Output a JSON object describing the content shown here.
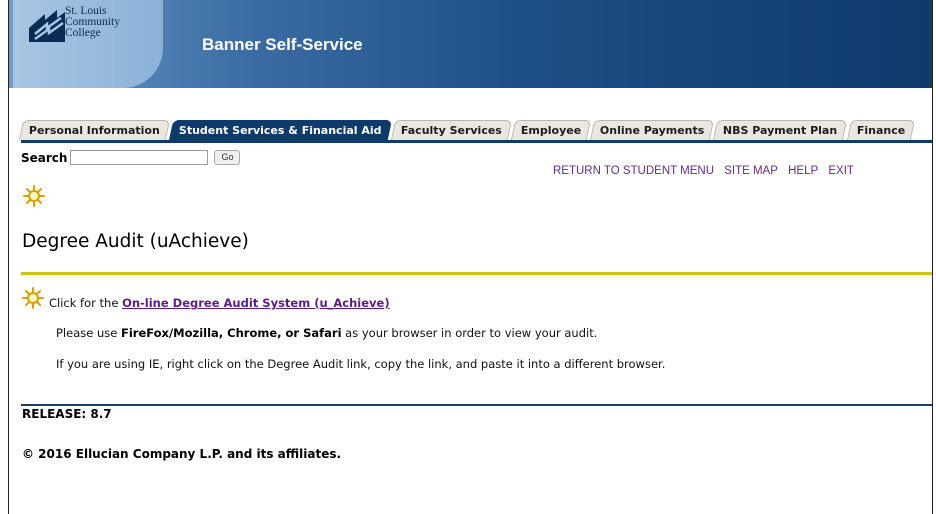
{
  "header": {
    "logo_lines": [
      "St. Louis",
      "Community",
      "College"
    ],
    "app_title": "Banner Self-Service"
  },
  "tabs": [
    {
      "label": "Personal Information",
      "active": false
    },
    {
      "label": "Student Services & Financial Aid",
      "active": true
    },
    {
      "label": "Faculty Services",
      "active": false
    },
    {
      "label": "Employee",
      "active": false
    },
    {
      "label": "Online Payments",
      "active": false
    },
    {
      "label": "NBS Payment Plan",
      "active": false
    },
    {
      "label": "Finance",
      "active": false
    }
  ],
  "search": {
    "label": "Search",
    "value": "",
    "button": "Go"
  },
  "top_links": [
    "RETURN TO STUDENT MENU",
    "SITE MAP",
    "HELP",
    "EXIT"
  ],
  "page_title": "Degree Audit (uAchieve)",
  "info": {
    "prefix": "Click for the ",
    "link": "On-line Degree Audit System (u_Achieve)"
  },
  "paragraphs": {
    "browsers_prefix": "Please use ",
    "browsers_bold": "FireFox/Mozilla, Chrome, or Safari",
    "browsers_suffix": " as your browser in order to view your audit.",
    "ie_note": "If you are using IE, right click on the Degree Audit link, copy the link, and paste it into a different browser."
  },
  "footer": {
    "release": "RELEASE: 8.7",
    "copyright": "© 2016 Ellucian Company L.P. and its affiliates."
  },
  "colors": {
    "header_dark": "#0f3a6c",
    "divider_green": "#c8c60e",
    "link_purple": "#6a2a89"
  },
  "icons": [
    "college-logo-icon",
    "sun-icon"
  ]
}
